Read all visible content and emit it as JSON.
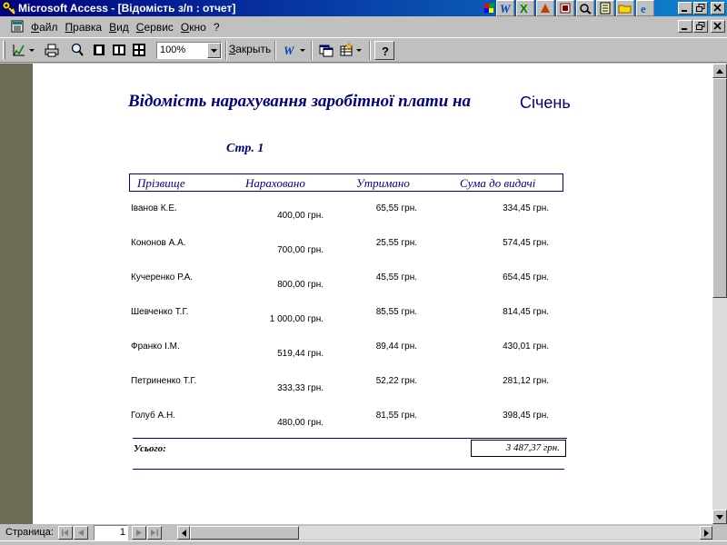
{
  "window": {
    "title": "Microsoft Access - [Відомість з/п : отчет]"
  },
  "menu": {
    "items": [
      "Файл",
      "Правка",
      "Вид",
      "Сервис",
      "Окно",
      "?"
    ]
  },
  "toolbar": {
    "zoom_value": "100%",
    "close_label": "Закрыть"
  },
  "report": {
    "title": "Відомість нарахування заробітної плати на",
    "month": "Січень",
    "page_label": "Стр. 1",
    "headers": [
      "Прізвище",
      "Нараховано",
      "Утримано",
      "Сума до видачі"
    ],
    "rows": [
      {
        "name": "Іванов К.Е.",
        "accrued": "400,00 грн.",
        "withheld": "65,55 грн.",
        "payout": "334,45 грн."
      },
      {
        "name": "Кононов А.А.",
        "accrued": "700,00 грн.",
        "withheld": "25,55 грн.",
        "payout": "574,45 грн."
      },
      {
        "name": "Кучеренко Р.А.",
        "accrued": "800,00 грн.",
        "withheld": "45,55 грн.",
        "payout": "654,45 грн."
      },
      {
        "name": "Шевченко Т.Г.",
        "accrued": "1 000,00 грн.",
        "withheld": "85,55 грн.",
        "payout": "814,45 грн."
      },
      {
        "name": "Франко І.М.",
        "accrued": "519,44 грн.",
        "withheld": "89,44 грн.",
        "payout": "430,01 грн."
      },
      {
        "name": "Петриненко Т.Г.",
        "accrued": "333,33 грн.",
        "withheld": "52,22 грн.",
        "payout": "281,12 грн."
      },
      {
        "name": "Голуб А.Н.",
        "accrued": "480,00 грн.",
        "withheld": "81,55 грн.",
        "payout": "398,45 грн."
      }
    ],
    "total_label": "Усього:",
    "total_value": "3 487,37 грн."
  },
  "status": {
    "page_label": "Страница:",
    "page_number": "1"
  },
  "colors": {
    "title_bar": "#000080",
    "report_text": "#000080",
    "workspace": "#808080",
    "left_panel": "#6b6b56"
  }
}
